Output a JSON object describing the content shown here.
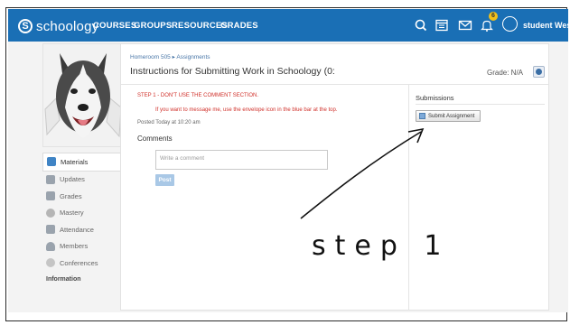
{
  "header": {
    "logo_text": "schoology",
    "logo_letter": "S",
    "nav": [
      "COURSES",
      "GROUPS",
      "RESOURCES",
      "GRADES"
    ],
    "notification_count": "6",
    "user_name": "student Wessel",
    "brand_color": "#1a6fb5",
    "icons": [
      "search-icon",
      "calendar-icon",
      "mail-icon",
      "bell-icon",
      "avatar-icon"
    ]
  },
  "sidebar": {
    "items": [
      {
        "label": "Materials",
        "active": true,
        "icon": "materials-icon",
        "color": "#3f84c5"
      },
      {
        "label": "Updates",
        "active": false,
        "icon": "updates-icon",
        "color": "#9aa3ad"
      },
      {
        "label": "Grades",
        "active": false,
        "icon": "grades-icon",
        "color": "#9aa3ad"
      },
      {
        "label": "Mastery",
        "active": false,
        "icon": "mastery-icon",
        "color": "#b5b5b5"
      },
      {
        "label": "Attendance",
        "active": false,
        "icon": "attendance-icon",
        "color": "#9aa3ad"
      },
      {
        "label": "Members",
        "active": false,
        "icon": "members-icon",
        "color": "#9aa3ad"
      },
      {
        "label": "Conferences",
        "active": false,
        "icon": "conferences-icon",
        "color": "#c5c5c5"
      }
    ],
    "section_heading": "Information"
  },
  "main": {
    "breadcrumb": "Homeroom 505 ▸ Assignments",
    "title": "Instructions for Submitting Work in Schoology (0:",
    "grade_label": "Grade:  N/A",
    "step_text": "STEP 1  - DON'T USE THE COMMENT SECTION.",
    "message_text": "If you want to message me, use the envelope icon in the blue bar at the top.",
    "posted": "Posted Today at 10:20 am",
    "comments_heading": "Comments",
    "comment_placeholder": "Write a comment",
    "post_label": "Post",
    "alert_color": "#d0302a"
  },
  "submissions": {
    "heading": "Submissions",
    "button_label": "Submit Assignment"
  },
  "annotation": {
    "handwritten": "step 1"
  }
}
